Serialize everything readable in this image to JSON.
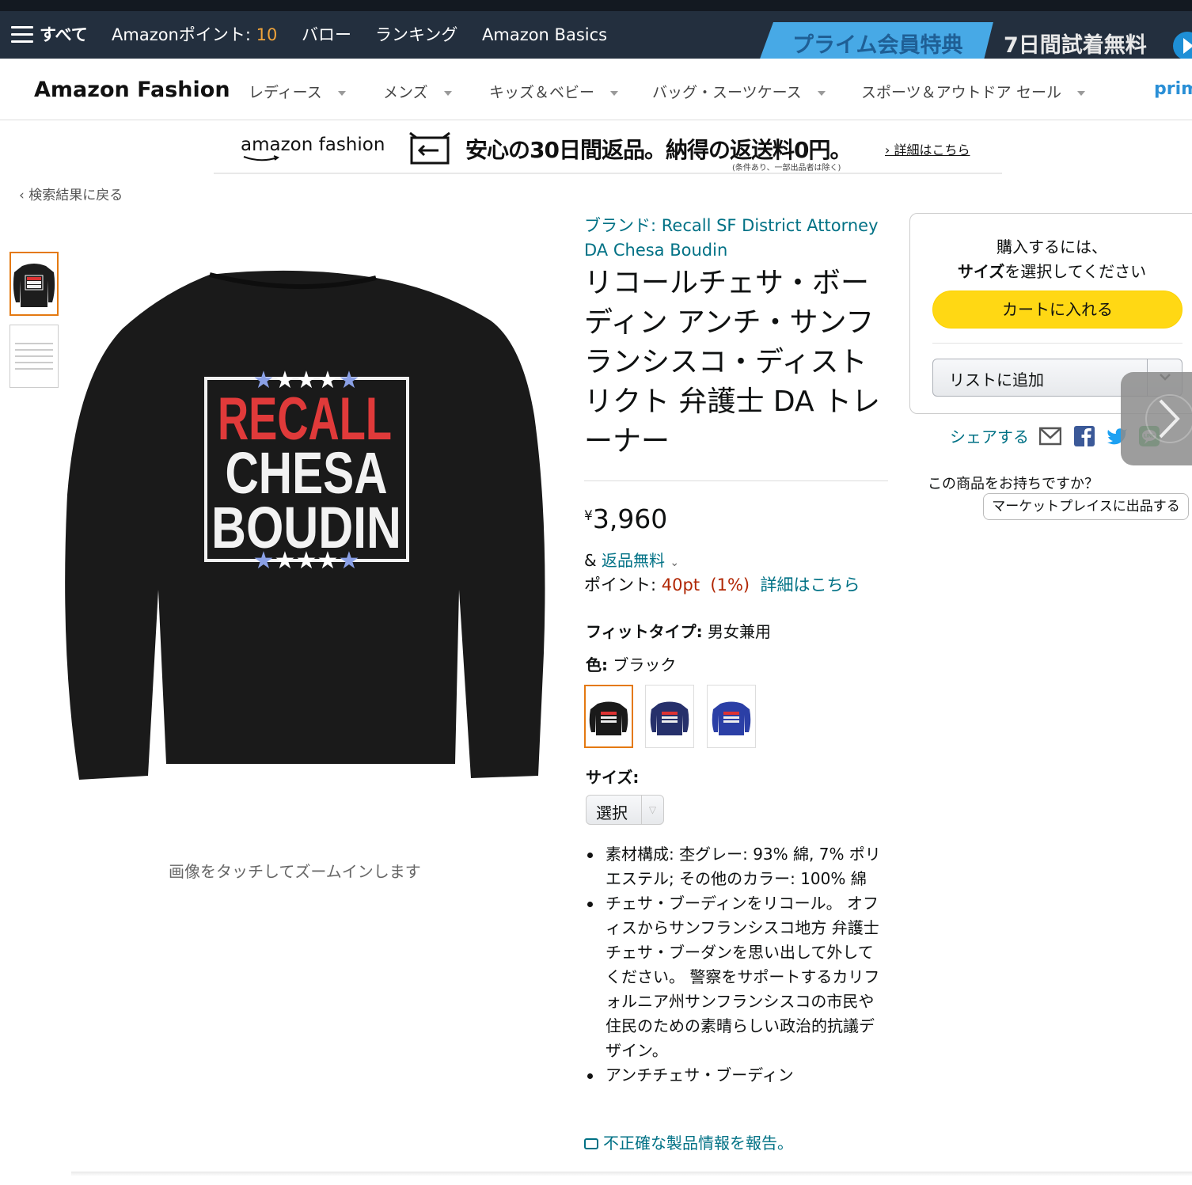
{
  "nav": {
    "all_label": "すべて",
    "points_label": "Amazonポイント: ",
    "points_value": "10",
    "links": [
      "バロー",
      "ランキング",
      "Amazon Basics"
    ],
    "prime_banner": "プライム会員特典",
    "trial_banner": "7日間試着無料"
  },
  "fashion_bar": {
    "title": "Amazon Fashion",
    "categories": [
      "レディース",
      "メンズ",
      "キッズ＆ベビー",
      "バッグ・スーツケース",
      "スポーツ＆アウトドア",
      "セール"
    ],
    "prime_label": "prim"
  },
  "promo": {
    "logo": "amazon fashion",
    "main": "安心の30日間返品。納得の返送料0円。",
    "sub": "(条件あり、一部出品者は除く)",
    "link": "詳細はこちら"
  },
  "back_link": "‹ 検索結果に戻る",
  "product": {
    "image_text": [
      "RECALL",
      "CHESA",
      "BOUDIN"
    ],
    "zoom_hint": "画像をタッチしてズームインします",
    "brand": "ブランド: Recall SF District Attorney DA Chesa Boudin",
    "title": "リコールチェサ・ボーディン アンチ・サンフランシスコ・ディストリクト 弁護士 DA トレーナー",
    "price_symbol": "¥",
    "price": "3,960",
    "returns_prefix": "& ",
    "returns_link": "返品無料",
    "points_label": "ポイント: ",
    "points_value": "40pt  (1%)",
    "points_link": "詳細はこちら",
    "fit_label": "フィットタイプ:",
    "fit_value": "男女兼用",
    "color_label": "色:",
    "color_value": "ブラック",
    "swatch_colors": [
      "#1a1a1a",
      "#26306b",
      "#2b3fa6"
    ],
    "size_label": "サイズ:",
    "size_select": "選択",
    "bullets": [
      "素材構成: 杢グレー: 93% 綿, 7% ポリエステル; その他のカラー: 100% 綿",
      "チェサ・ブーディンをリコール。 オフィスからサンフランシスコ地方 弁護士 チェサ・ブーダンを思い出して外してください。 警察をサポートするカリフォルニア州サンフランシスコの市民や住民のための素晴らしい政治的抗議デザイン。",
      "アンチチェサ・ブーディン"
    ],
    "report_link": "不正確な製品情報を報告。"
  },
  "buybox": {
    "msg_line1": "購入するには、",
    "msg_bold": "サイズ",
    "msg_line2_rest": "を選択してください",
    "cart_button": "カートに入れる",
    "list_button": "リストに追加",
    "share_label": "シェアする",
    "have_item": "この商品をお持ちですか？",
    "marketplace_button": "マーケットプレイスに出品する"
  },
  "colors": {
    "nav_bg": "#232f3e",
    "link": "#007185",
    "price_red": "#b12704",
    "cart_yellow": "#ffd814",
    "selected_orange": "#e47911"
  }
}
